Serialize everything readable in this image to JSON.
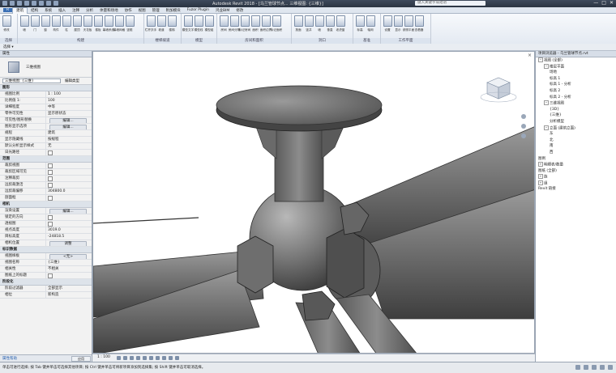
{
  "titlebar": {
    "title": "Autodesk Revit 2018 - [乌兰管球节点... 三维视图: {三维}]",
    "search_placeholder": "键入关键字或短语",
    "controls": [
      "—",
      "□",
      "✕"
    ]
  },
  "menu_tabs": [
    "R",
    "建筑",
    "结构",
    "系统",
    "插入",
    "注释",
    "分析",
    "体量和场地",
    "协作",
    "视图",
    "管理",
    "附加模块",
    "Fuzor Plugin",
    "鸿业BIM",
    "修改"
  ],
  "ribbon": {
    "groups": [
      {
        "name": "选择",
        "buttons": [
          "修改"
        ]
      },
      {
        "name": "构建",
        "buttons": [
          "墙",
          "门",
          "窗",
          "构件",
          "柱",
          "屋顶",
          "天花板",
          "楼板",
          "幕墙系统",
          "幕墙网格",
          "竖梃"
        ]
      },
      {
        "name": "楼梯坡道",
        "buttons": [
          "栏杆扶手",
          "坡道",
          "楼梯"
        ]
      },
      {
        "name": "模型",
        "buttons": [
          "模型文字",
          "模型线",
          "模型组"
        ]
      },
      {
        "name": "房间和面积",
        "buttons": [
          "房间",
          "房间分隔",
          "标记房间",
          "面积",
          "面积边界",
          "标记面积"
        ]
      },
      {
        "name": "洞口",
        "buttons": [
          "按面",
          "竖井",
          "墙",
          "垂直",
          "老虎窗"
        ]
      },
      {
        "name": "基准",
        "buttons": [
          "标高",
          "轴网"
        ]
      },
      {
        "name": "工作平面",
        "buttons": [
          "设置",
          "显示",
          "参照平面",
          "查看器"
        ]
      }
    ]
  },
  "selection_bar": {
    "label": "选择 ▾"
  },
  "properties": {
    "header": "属性",
    "type_name": "三维视图",
    "selector": "三维视图: {三维}",
    "edit_type": "编辑类型",
    "sections": [
      {
        "name": "图形",
        "rows": [
          {
            "k": "视图比例",
            "v": "1 : 100"
          },
          {
            "k": "比例值 1:",
            "v": "100"
          },
          {
            "k": "详细程度",
            "v": "中等"
          },
          {
            "k": "零件可见性",
            "v": "显示原状态"
          },
          {
            "k": "可见性/图形替换",
            "v": "编辑..."
          },
          {
            "k": "图形显示选项",
            "v": "编辑..."
          },
          {
            "k": "规程",
            "v": "建筑"
          },
          {
            "k": "显示隐藏线",
            "v": "按规程"
          },
          {
            "k": "默认分析显示样式",
            "v": "无"
          },
          {
            "k": "日光路径",
            "v": ""
          }
        ]
      },
      {
        "name": "范围",
        "rows": [
          {
            "k": "裁剪视图",
            "v": ""
          },
          {
            "k": "裁剪区域可见",
            "v": ""
          },
          {
            "k": "注释裁剪",
            "v": ""
          },
          {
            "k": "远剪裁激活",
            "v": ""
          },
          {
            "k": "远剪裁偏移",
            "v": "304800.0"
          },
          {
            "k": "剖面框",
            "v": ""
          }
        ]
      },
      {
        "name": "相机",
        "rows": [
          {
            "k": "渲染设置",
            "v": "编辑..."
          },
          {
            "k": "锁定的方向",
            "v": ""
          },
          {
            "k": "透视图",
            "v": ""
          },
          {
            "k": "视点高度",
            "v": "3019.0"
          },
          {
            "k": "目标高度",
            "v": "-24818.5"
          },
          {
            "k": "相机位置",
            "v": "调整"
          }
        ]
      },
      {
        "name": "标识数据",
        "rows": [
          {
            "k": "视图样板",
            "v": "<无>"
          },
          {
            "k": "视图名称",
            "v": "{三维}"
          },
          {
            "k": "相关性",
            "v": "不相关"
          },
          {
            "k": "图纸上的标题",
            "v": ""
          }
        ]
      },
      {
        "name": "阶段化",
        "rows": [
          {
            "k": "阶段过滤器",
            "v": "全部显示"
          },
          {
            "k": "相位",
            "v": "新构造"
          }
        ]
      }
    ],
    "help_link": "属性帮助",
    "apply_label": "应用"
  },
  "viewbar": {
    "scale": "1 : 100"
  },
  "browser": {
    "header": "项目浏览器 - 乌兰管球节点.rvt",
    "nodes": [
      {
        "label": "视图 (全部)",
        "level": 0,
        "toggle": "−"
      },
      {
        "label": "楼层平面",
        "level": 1,
        "toggle": "−"
      },
      {
        "label": "场地",
        "level": 2,
        "toggle": ""
      },
      {
        "label": "标高 1",
        "level": 2,
        "toggle": ""
      },
      {
        "label": "标高 1 - 分析",
        "level": 2,
        "toggle": ""
      },
      {
        "label": "标高 2",
        "level": 2,
        "toggle": ""
      },
      {
        "label": "标高 2 - 分析",
        "level": 2,
        "toggle": ""
      },
      {
        "label": "三维视图",
        "level": 1,
        "toggle": "−"
      },
      {
        "label": "{3D}",
        "level": 2,
        "toggle": ""
      },
      {
        "label": "{三维}",
        "level": 2,
        "toggle": ""
      },
      {
        "label": "分析模型",
        "level": 2,
        "toggle": ""
      },
      {
        "label": "立面 (建筑立面)",
        "level": 1,
        "toggle": "−"
      },
      {
        "label": "东",
        "level": 2,
        "toggle": ""
      },
      {
        "label": "北",
        "level": 2,
        "toggle": ""
      },
      {
        "label": "南",
        "level": 2,
        "toggle": ""
      },
      {
        "label": "西",
        "level": 2,
        "toggle": ""
      },
      {
        "label": "图例",
        "level": 0,
        "toggle": ""
      },
      {
        "label": "明细表/数量",
        "level": 0,
        "toggle": "+"
      },
      {
        "label": "图纸 (全部)",
        "level": 0,
        "toggle": ""
      },
      {
        "label": "族",
        "level": 0,
        "toggle": "+"
      },
      {
        "label": "组",
        "level": 0,
        "toggle": "+"
      },
      {
        "label": "Revit 链接",
        "level": 0,
        "toggle": ""
      }
    ]
  },
  "statusbar": {
    "message": "单击可进行选择; 按 Tab 键并单击可选择其他项目; 按 Ctrl 键并单击可将新项目添加到选择集; 按 Shift 键并单击可取消选择。"
  }
}
